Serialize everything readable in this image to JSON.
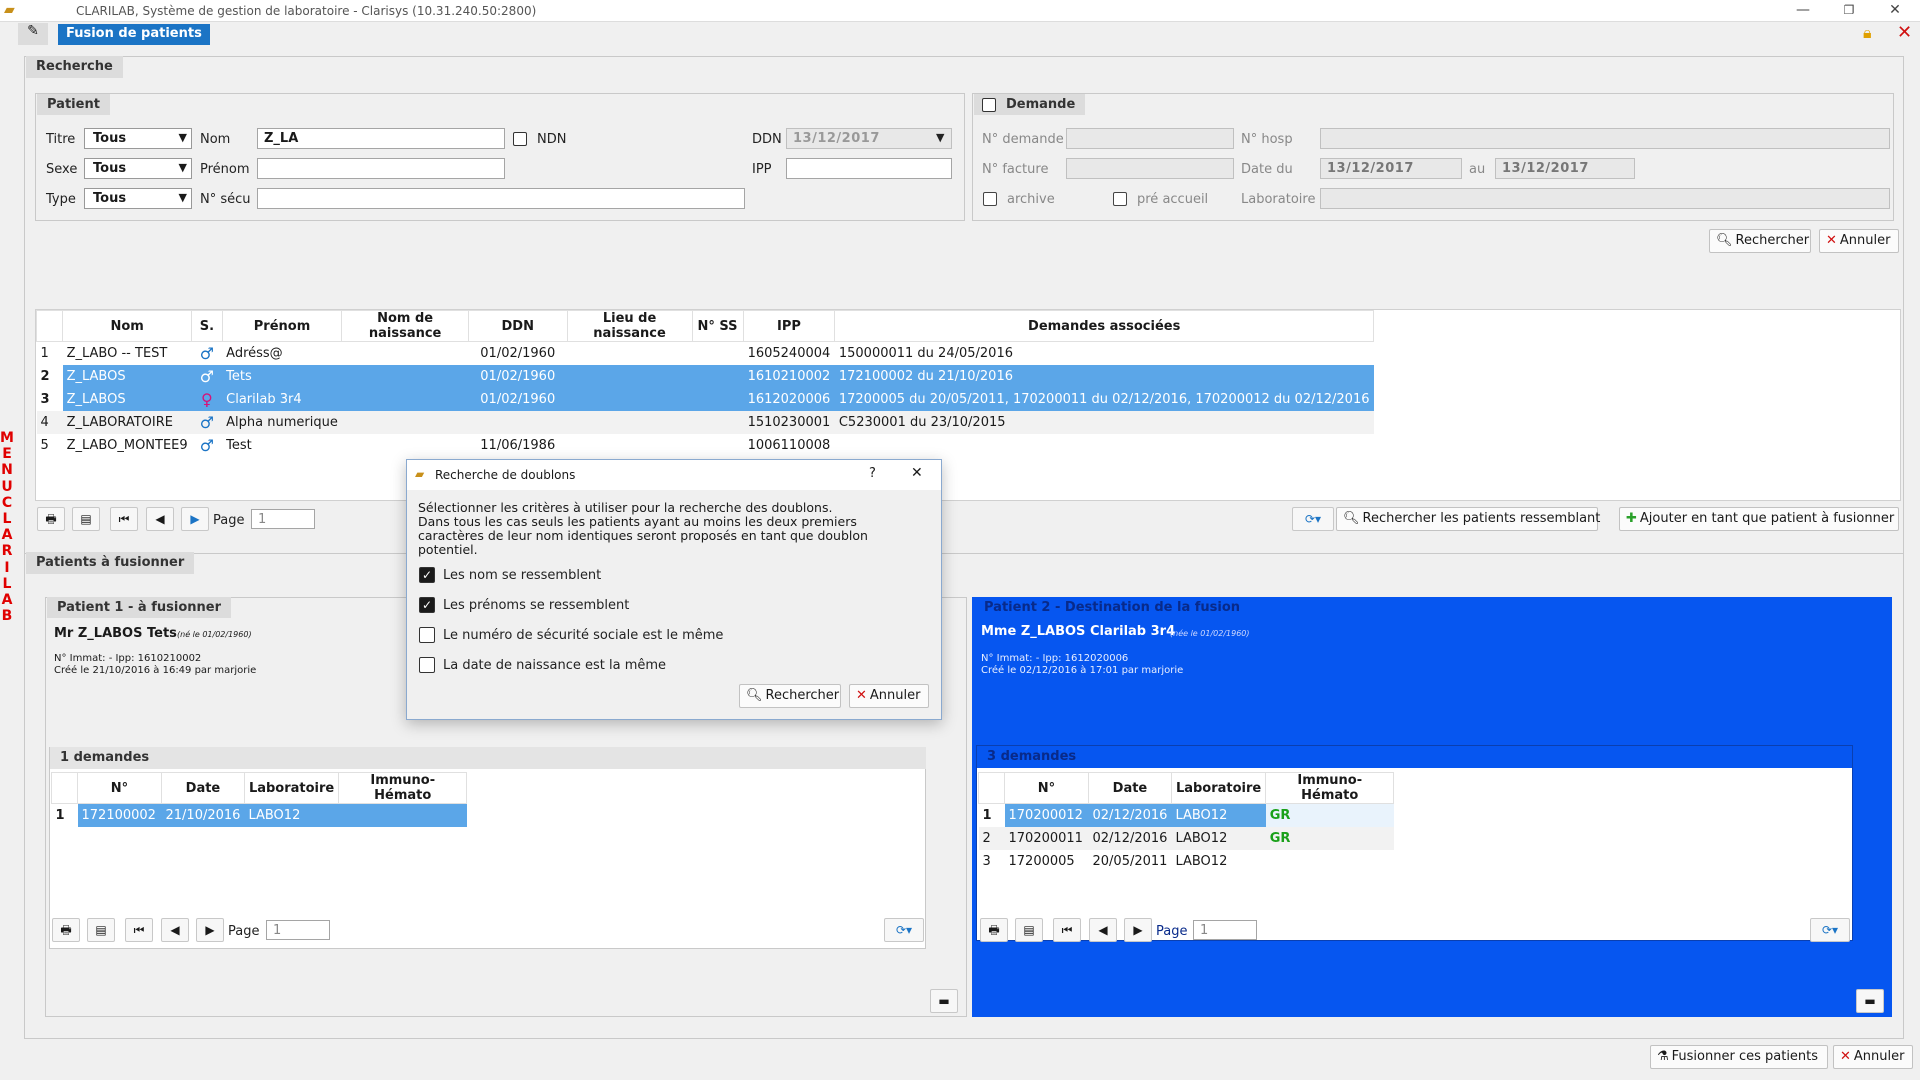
{
  "app": {
    "title": "CLARILAB, Système de gestion de laboratoire - Clarisys (10.31.240.50:2800)",
    "tab": "Fusion de patients"
  },
  "left_menu": {
    "letters": [
      "M",
      "E",
      "N",
      "U",
      "",
      "C",
      "L",
      "A",
      "R",
      "I",
      "L",
      "A",
      "B"
    ]
  },
  "search": {
    "section": "Recherche",
    "patient": {
      "section": "Patient",
      "titre_label": "Titre",
      "titre_value": "Tous",
      "sexe_label": "Sexe",
      "sexe_value": "Tous",
      "type_label": "Type",
      "type_value": "Tous",
      "nom_label": "Nom",
      "nom_value": "Z_LA",
      "prenom_label": "Prénom",
      "prenom_value": "",
      "nsecu_label": "N° sécu",
      "nsecu_value": "",
      "ndn_label": "NDN",
      "ddn_label": "DDN",
      "ddn_value": "13/12/2017",
      "ipp_label": "IPP",
      "ipp_value": ""
    },
    "demande": {
      "section": "Demande",
      "ndemande_label": "N° demande",
      "nhosp_label": "N° hosp",
      "nfacture_label": "N° facture",
      "datedu_label": "Date du",
      "datedu_value": "13/12/2017",
      "au_label": "au",
      "au_value": "13/12/2017",
      "archive_label": "archive",
      "preaccueil_label": "pré accueil",
      "laboratoire_label": "Laboratoire"
    },
    "rechercher": "Rechercher",
    "annuler": "Annuler"
  },
  "results": {
    "columns": [
      "Nom",
      "S.",
      "Prénom",
      "Nom de naissance",
      "DDN",
      "Lieu de naissance",
      "N° SS",
      "IPP",
      "Demandes associées"
    ],
    "rows": [
      {
        "n": "1",
        "nom": "Z_LABO -- TEST",
        "sexe": "♂",
        "prenom": "Adréss@",
        "ddn": "01/02/1960",
        "ipp": "1605240004",
        "demandes": "150000011 du 24/05/2016"
      },
      {
        "n": "2",
        "nom": "Z_LABOS",
        "sexe": "♂",
        "prenom": "Tets",
        "ddn": "01/02/1960",
        "ipp": "1610210002",
        "demandes": "172100002 du 21/10/2016"
      },
      {
        "n": "3",
        "nom": "Z_LABOS",
        "sexe": "♀",
        "prenom": "Clarilab 3r4",
        "ddn": "01/02/1960",
        "ipp": "1612020006",
        "demandes": "17200005 du 20/05/2011, 170200011 du 02/12/2016, 170200012 du 02/12/2016"
      },
      {
        "n": "4",
        "nom": "Z_LABORATOIRE",
        "sexe": "♂",
        "prenom": "Alpha numerique",
        "ddn": "",
        "ipp": "1510230001",
        "demandes": "C5230001 du 23/10/2015"
      },
      {
        "n": "5",
        "nom": "Z_LABO_MONTEE9",
        "sexe": "♂",
        "prenom": "Test",
        "ddn": "11/06/1986",
        "ipp": "1006110008",
        "demandes": ""
      }
    ],
    "page_label": "Page",
    "page_value": "1",
    "similar_btn": "Rechercher les patients ressemblant",
    "add_btn": "Ajouter en tant que patient à fusionner"
  },
  "merge": {
    "section": "Patients à fusionner",
    "p1": {
      "section": "Patient 1 - à fusionner",
      "name": "Mr Z_LABOS Tets",
      "born": "(né le 01/02/1960)",
      "immat": "N° Immat: - Ipp: 1610210002",
      "created": "Créé le 21/10/2016 à 16:49 par marjorie",
      "demandes_section": "1 demandes",
      "columns": [
        "N°",
        "Date",
        "Laboratoire",
        "Immuno-Hémato"
      ],
      "rows": [
        {
          "n": "1",
          "num": "172100002",
          "date": "21/10/2016",
          "lab": "LABO12",
          "immuno": ""
        }
      ],
      "page_label": "Page",
      "page_value": "1"
    },
    "p2": {
      "section": "Patient 2 - Destination de la fusion",
      "name": "Mme Z_LABOS Clarilab 3r4",
      "born": "(née le 01/02/1960)",
      "immat": "N° Immat: - Ipp: 1612020006",
      "created": "Créé le 02/12/2016 à 17:01 par marjorie",
      "demandes_section": "3 demandes",
      "columns": [
        "N°",
        "Date",
        "Laboratoire",
        "Immuno-Hémato"
      ],
      "rows": [
        {
          "n": "1",
          "num": "170200012",
          "date": "02/12/2016",
          "lab": "LABO12",
          "immuno": "GR"
        },
        {
          "n": "2",
          "num": "170200011",
          "date": "02/12/2016",
          "lab": "LABO12",
          "immuno": "GR"
        },
        {
          "n": "3",
          "num": "17200005",
          "date": "20/05/2011",
          "lab": "LABO12",
          "immuno": ""
        }
      ],
      "page_label": "Page",
      "page_value": "1"
    },
    "fusionner": "Fusionner ces patients",
    "annuler": "Annuler"
  },
  "dialog": {
    "title": "Recherche de doublons",
    "help": "?",
    "close": "✕",
    "text": "Sélectionner les critères à utiliser pour la recherche des doublons.\nDans tous les cas seuls les patients ayant au moins les deux premiers caractères de leur nom identiques seront proposés en tant que doublon potentiel.",
    "options": [
      {
        "label": "Les nom se ressemblent",
        "checked": true
      },
      {
        "label": "Les prénoms se ressemblent",
        "checked": true
      },
      {
        "label": "Le numéro de sécurité sociale est le même",
        "checked": false
      },
      {
        "label": "La date de naissance est la même",
        "checked": false
      }
    ],
    "rechercher": "Rechercher",
    "annuler": "Annuler"
  },
  "colors": {
    "accent": "#1b74c5",
    "selection": "#5ba6e8",
    "destination": "#0656f0",
    "menu": "#e00000"
  }
}
